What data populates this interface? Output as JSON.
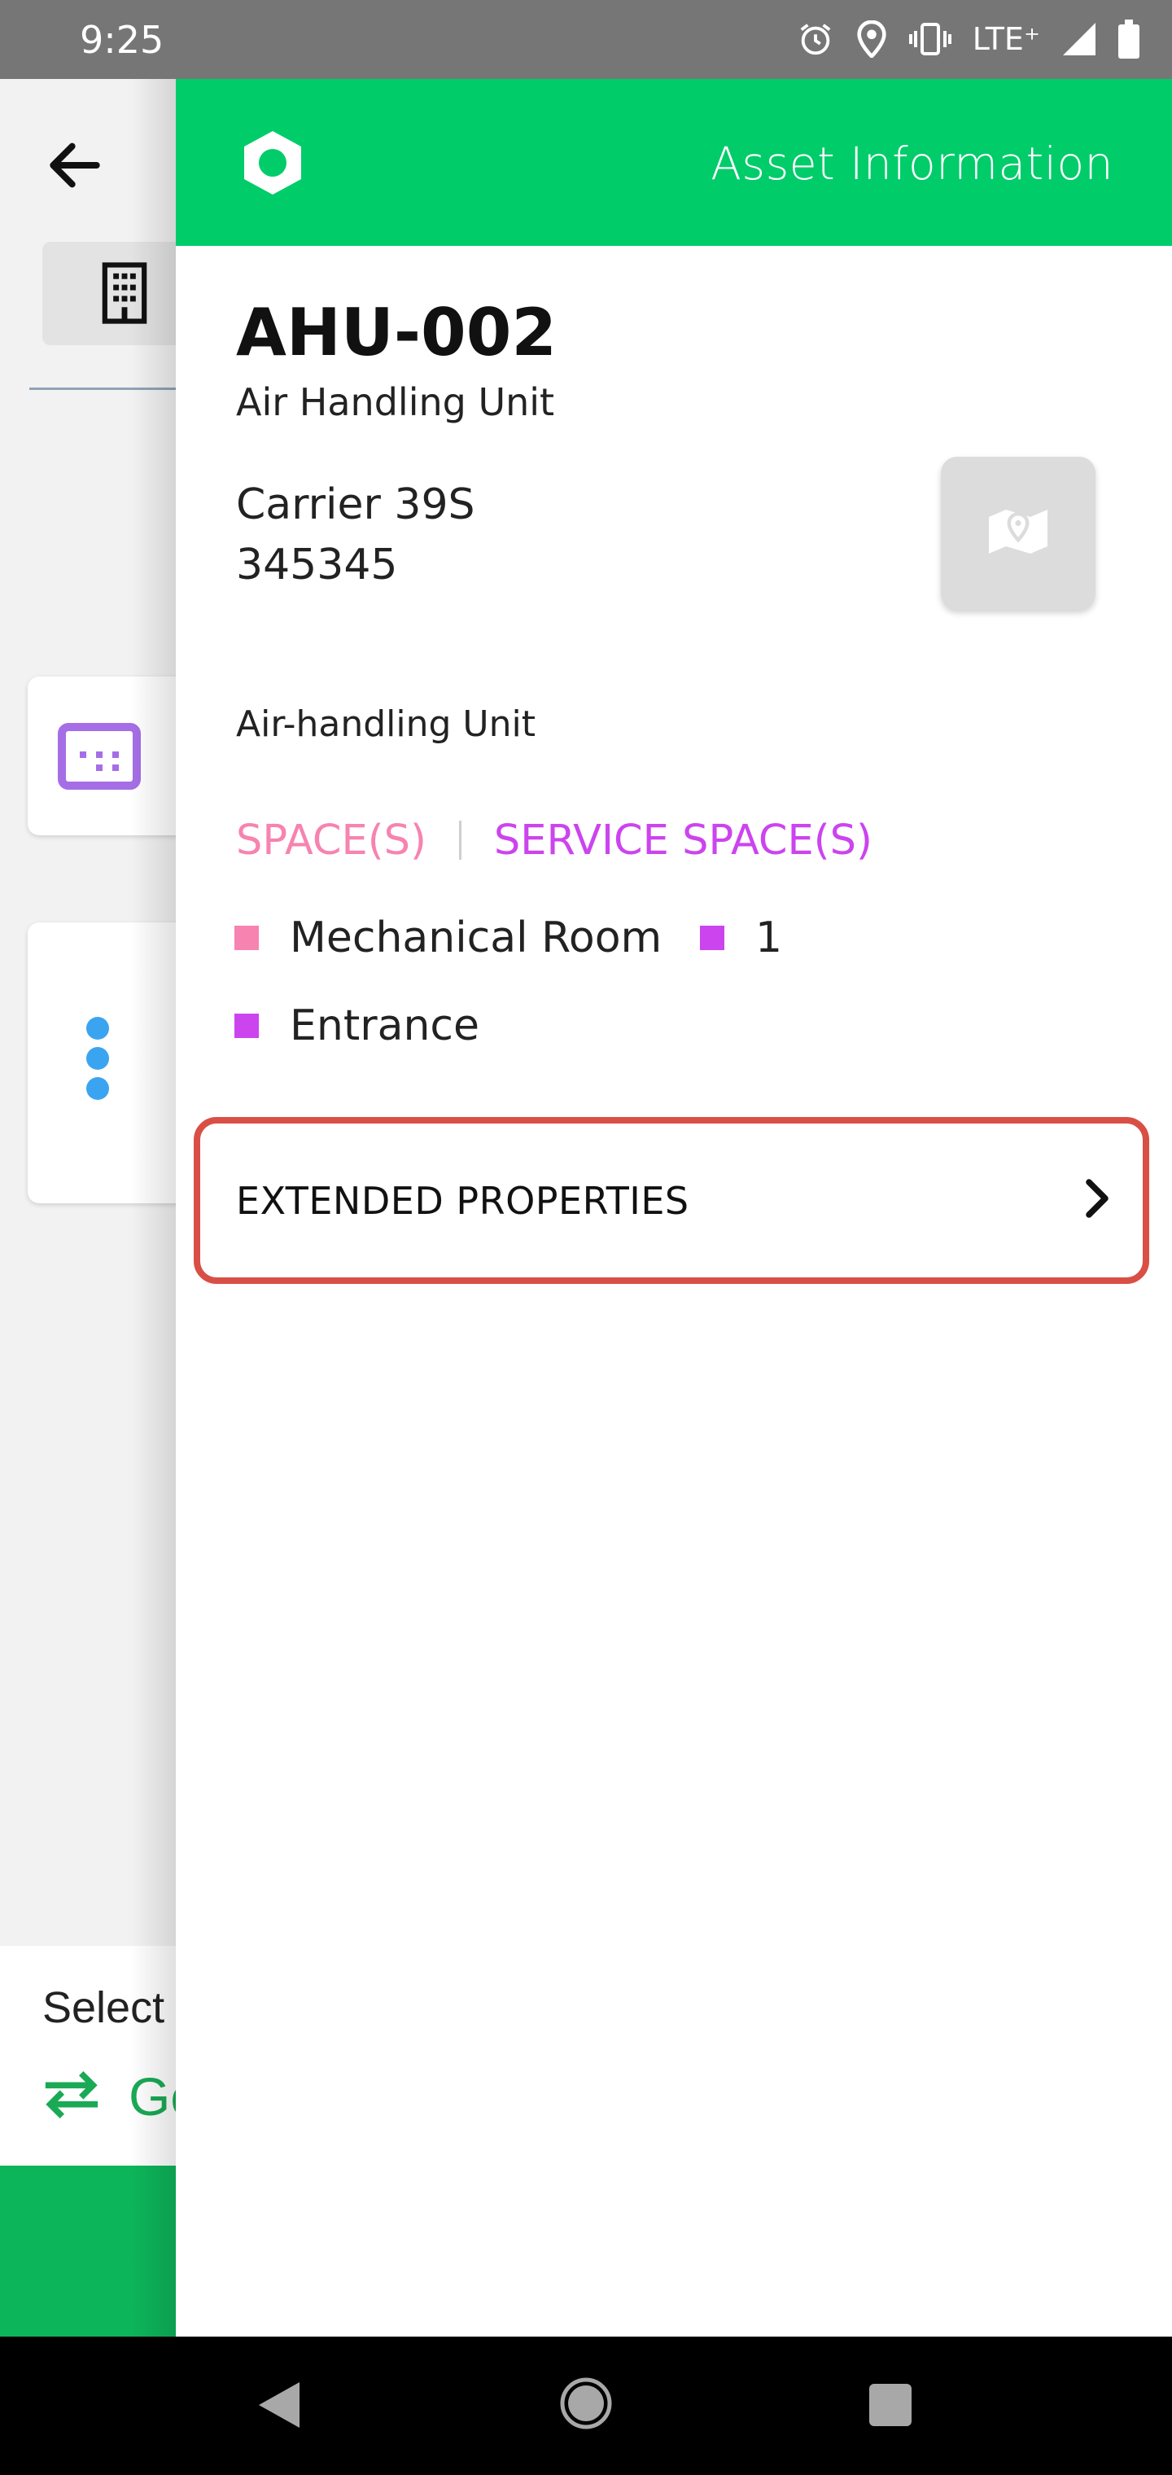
{
  "status_bar": {
    "time": "9:25",
    "network_label": "LTE⁺",
    "icons": [
      "alarm-icon",
      "location-icon",
      "vibrate-icon",
      "signal-icon",
      "battery-icon"
    ]
  },
  "background": {
    "select_label": "Select",
    "go_label": "Go"
  },
  "drawer": {
    "header_title": "Asset Information",
    "asset": {
      "name": "AHU-002",
      "type": "Air Handling Unit",
      "model": "Carrier 39S",
      "serial": "345345",
      "category": "Air-handling Unit"
    },
    "tabs": {
      "spaces": "SPACE(S)",
      "service_spaces": "SERVICE SPACE(S)"
    },
    "spaces": [
      {
        "label": "Mechanical Room",
        "color": "#f783b0"
      },
      {
        "label": "1",
        "color": "#cc44ee"
      },
      {
        "label": "Entrance",
        "color": "#cc44ee"
      }
    ],
    "extended_properties_label": "EXTENDED PROPERTIES"
  },
  "colors": {
    "brand_green": "#00cc6a",
    "space_pink": "#f783b0",
    "service_purple": "#cc44ee",
    "highlight_red": "#d94f45"
  }
}
